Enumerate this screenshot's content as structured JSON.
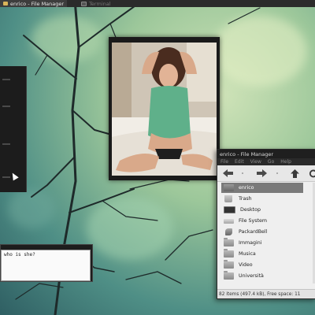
{
  "taskbar": {
    "tasks": [
      {
        "label": "enrico - File Manager",
        "icon": "folder-icon"
      },
      {
        "label": "Terminal",
        "icon": "terminal-icon"
      }
    ]
  },
  "chat": {
    "message": "who is she?"
  },
  "file_manager": {
    "title": "enrico - File Manager",
    "menu": [
      "File",
      "Edit",
      "View",
      "Go",
      "Help"
    ],
    "toolbar_icons": [
      "back-arrow-icon",
      "forward-arrow-icon",
      "up-arrow-icon",
      "reload-icon"
    ],
    "places": [
      {
        "label": "enrico",
        "icon": "home-folder-icon",
        "selected": true
      },
      {
        "label": "Trash",
        "icon": "trash-icon",
        "selected": false
      },
      {
        "label": "Desktop",
        "icon": "desktop-icon",
        "selected": false
      },
      {
        "label": "File System",
        "icon": "drive-icon",
        "selected": false
      },
      {
        "label": "PackardBell",
        "icon": "removable-drive-icon",
        "selected": false
      },
      {
        "label": "Immagini",
        "icon": "folder-icon",
        "selected": false
      },
      {
        "label": "Musica",
        "icon": "folder-icon",
        "selected": false
      },
      {
        "label": "Video",
        "icon": "folder-icon",
        "selected": false
      },
      {
        "label": "Università",
        "icon": "folder-icon",
        "selected": false
      }
    ],
    "status": "82 items (497.4 kB), Free space: 11"
  },
  "colors": {
    "selection": "#7a7a7a",
    "window_title_bg": "#1f1f1f",
    "shirt": "#5fb08a"
  }
}
